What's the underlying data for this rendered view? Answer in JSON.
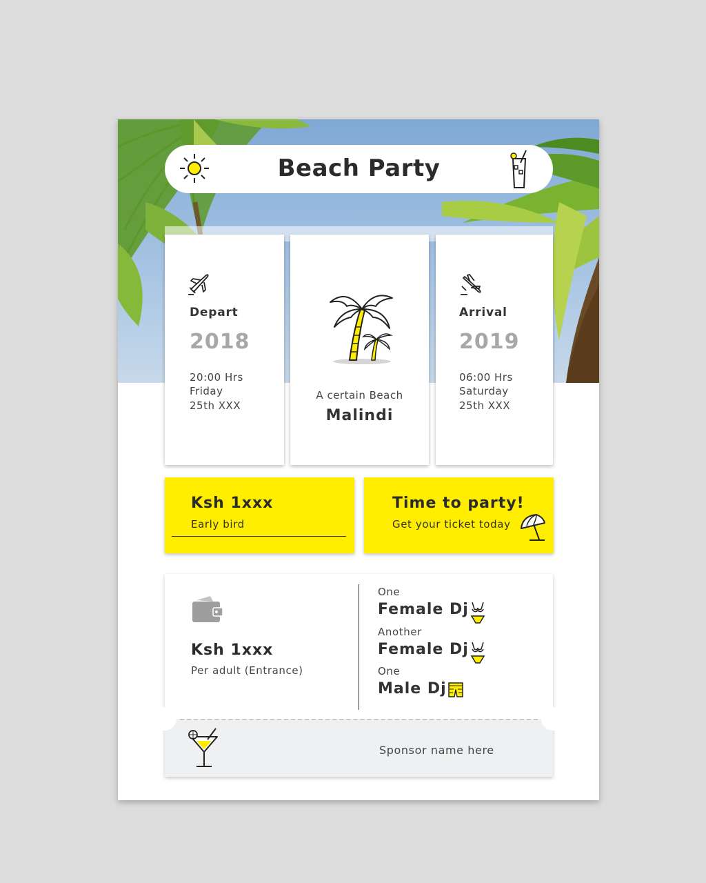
{
  "header": {
    "title": "Beach Party"
  },
  "depart": {
    "label": "Depart",
    "year": "2018",
    "time": "20:00 Hrs",
    "day": "Friday",
    "date": "25th XXX"
  },
  "location": {
    "caption": "A certain Beach",
    "name": "Malindi"
  },
  "arrival": {
    "label": "Arrival",
    "year": "2019",
    "time": "06:00 Hrs",
    "day": "Saturday",
    "date": "25th XXX"
  },
  "early_bird": {
    "price": "Ksh 1xxx",
    "label": "Early bird"
  },
  "promo": {
    "title": "Time to party!",
    "subtitle": "Get your ticket today"
  },
  "entrance": {
    "price": "Ksh 1xxx",
    "label": "Per adult (Entrance)"
  },
  "djs": [
    {
      "prefix": "One",
      "name": "Female Dj",
      "icon": "bikini-icon"
    },
    {
      "prefix": "Another",
      "name": "Female Dj",
      "icon": "bikini-icon"
    },
    {
      "prefix": "One",
      "name": "Male Dj",
      "icon": "swim-shorts-icon"
    }
  ],
  "sponsor": {
    "text": "Sponsor name here"
  },
  "colors": {
    "accent": "#ffee00",
    "text": "#333333",
    "year": "#a7a7a7",
    "stub": "#eff0f2"
  }
}
